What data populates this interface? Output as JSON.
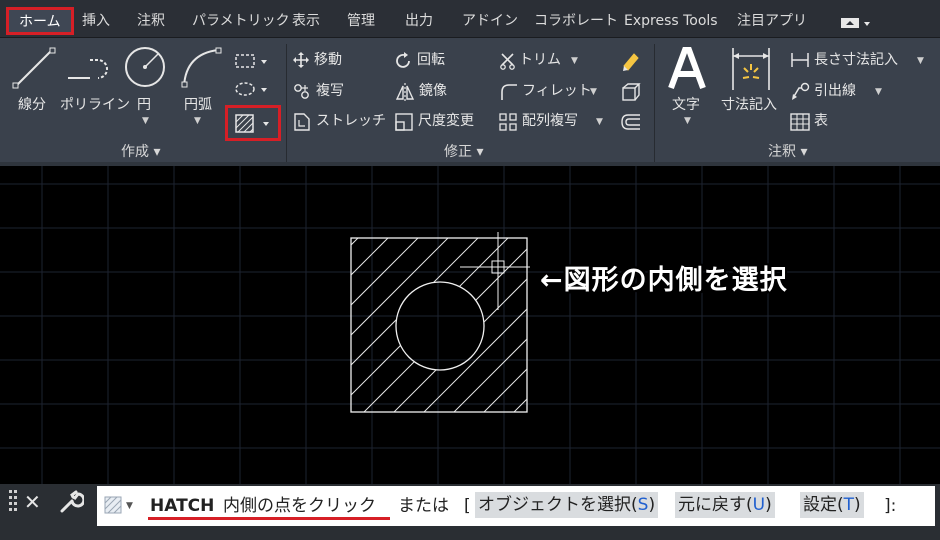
{
  "menu": {
    "tabs": [
      {
        "label": "ホーム",
        "active": true
      },
      {
        "label": "挿入"
      },
      {
        "label": "注釈"
      },
      {
        "label": "パラメトリック"
      },
      {
        "label": "表示"
      },
      {
        "label": "管理"
      },
      {
        "label": "出力"
      },
      {
        "label": "アドイン"
      },
      {
        "label": "コラボレート"
      },
      {
        "label": "Express Tools"
      },
      {
        "label": "注目アプリ"
      }
    ]
  },
  "ribbon": {
    "create_panel": {
      "title": "作成 ▾",
      "line": "線分",
      "polyline": "ポリライン",
      "circle": "円",
      "arc": "円弧"
    },
    "modify_panel": {
      "title": "修正 ▾",
      "move": "移動",
      "rotate": "回転",
      "trim": "トリム",
      "copy": "複写",
      "mirror": "鏡像",
      "fillet": "フィレット",
      "stretch": "ストレッチ",
      "scale": "尺度変更",
      "array": "配列複写"
    },
    "annotation_panel": {
      "title": "注釈 ▾",
      "text": "文字",
      "dimension": "寸法記入",
      "linear_dim": "長さ寸法記入",
      "leader": "引出線",
      "table": "表"
    }
  },
  "canvas": {
    "callout": "←図形の内側を選択"
  },
  "command": {
    "name": "HATCH",
    "prompt": "内側の点をクリック",
    "or": "または",
    "bracket_open": "[",
    "bracket_close": "]:",
    "opt1": {
      "label": "オブジェクトを選択",
      "key": "S"
    },
    "opt2": {
      "label": "元に戻す",
      "key": "U"
    },
    "opt3": {
      "label": "設定",
      "key": "T"
    }
  },
  "colors": {
    "highlight": "#d61f26",
    "ribbon": "#3a414c",
    "canvas": "#000000",
    "option_key": "#1f5fcf"
  }
}
